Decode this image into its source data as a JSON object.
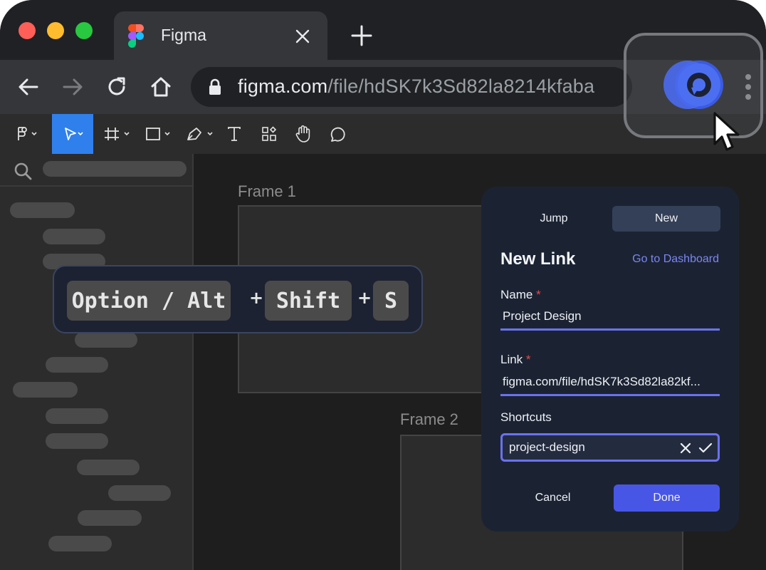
{
  "browser": {
    "tab_title": "Figma",
    "url_host": "figma.com",
    "url_path": "/file/hdSK7k3Sd82la8214kfaba",
    "traffic_lights": [
      "#ff5f57",
      "#febc2e",
      "#28c840"
    ]
  },
  "figma": {
    "frames": [
      {
        "label": "Frame 1"
      },
      {
        "label": "Frame 2"
      }
    ]
  },
  "shortcut_hint": {
    "keys": [
      "Option / Alt",
      "Shift",
      "S"
    ],
    "separator": "+"
  },
  "popup": {
    "tabs": [
      {
        "label": "Jump",
        "selected": false
      },
      {
        "label": "New",
        "selected": true
      }
    ],
    "title": "New Link",
    "dashboard_link": "Go to Dashboard",
    "name_label": "Name",
    "name_value": "Project Design",
    "link_label": "Link",
    "link_value": "figma.com/file/hdSK7k3Sd82la82kf...",
    "required_mark": "*",
    "shortcuts_label": "Shortcuts",
    "shortcuts_value": "project-design",
    "cancel_label": "Cancel",
    "done_label": "Done",
    "accent_color": "#4856e6"
  }
}
